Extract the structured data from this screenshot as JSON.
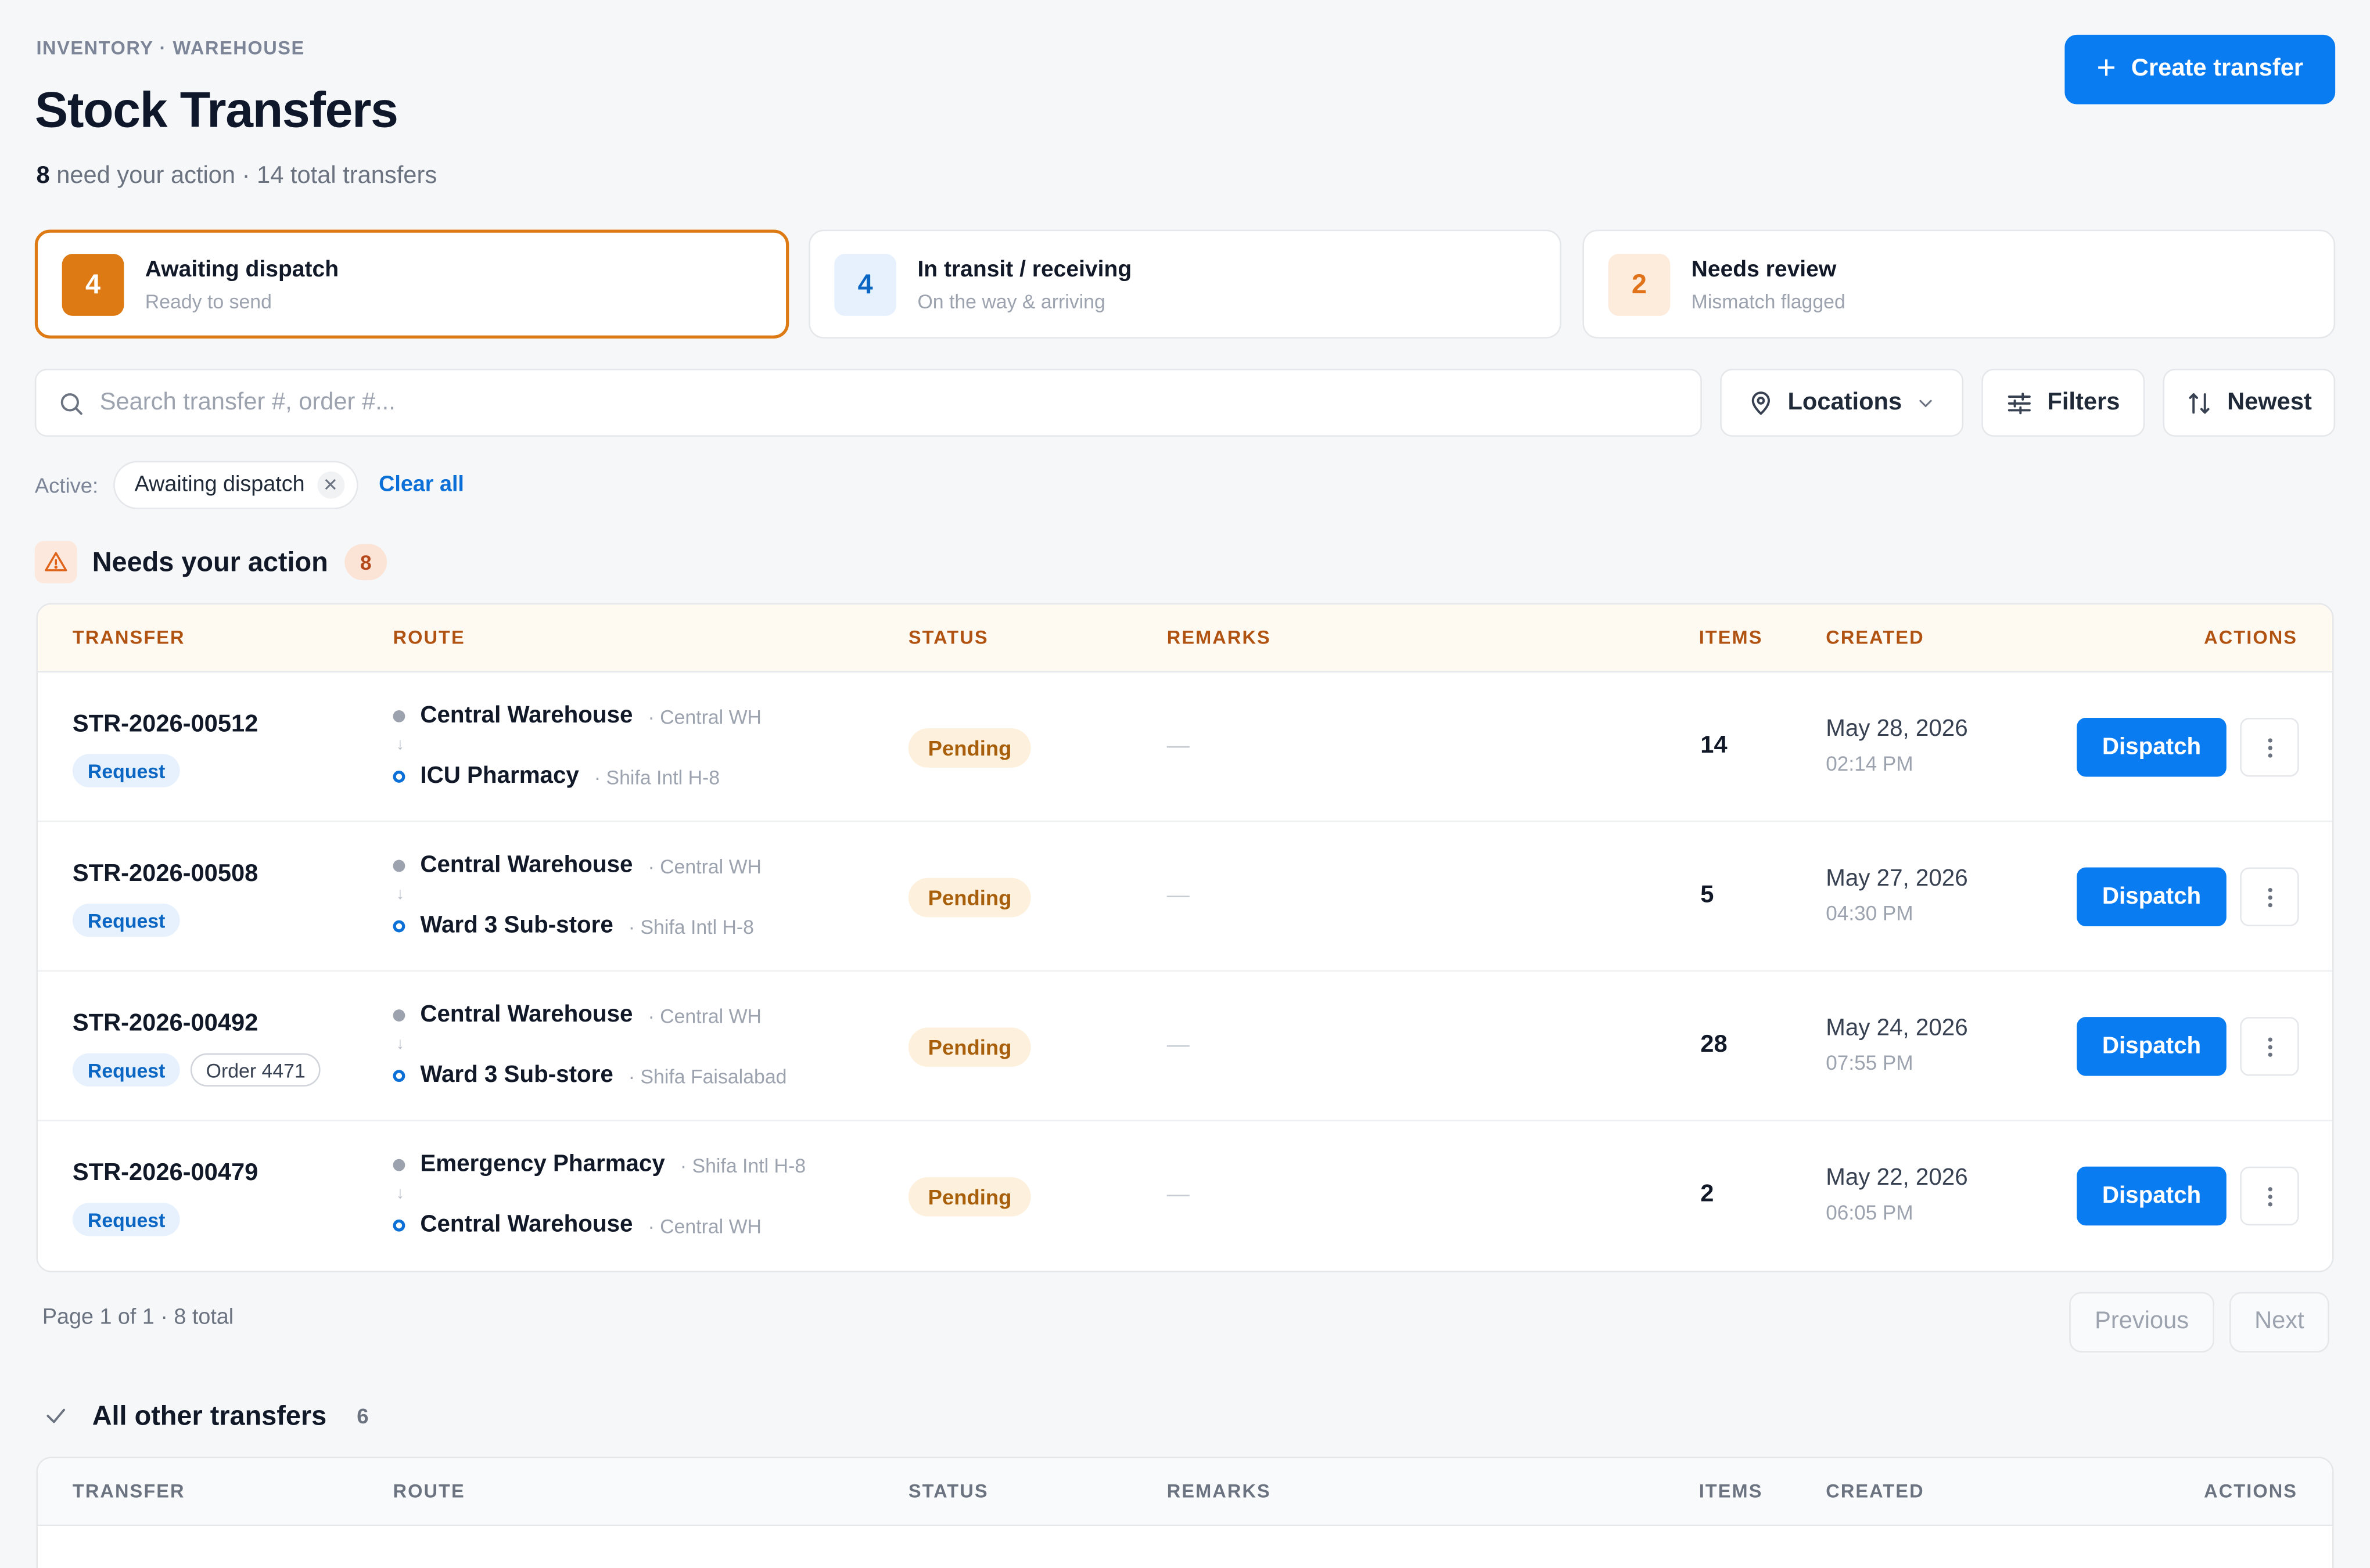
{
  "header": {
    "breadcrumb": "INVENTORY · WAREHOUSE",
    "title": "Stock Transfers",
    "action_count": "8",
    "subtitle_rest": "need your action · 14 total transfers",
    "create_label": "Create transfer"
  },
  "summary_cards": [
    {
      "count": "4",
      "title": "Awaiting dispatch",
      "subtitle": "Ready to send",
      "active": true,
      "color": "#dd7a14"
    },
    {
      "count": "4",
      "title": "In transit / receiving",
      "subtitle": "On the way & arriving",
      "active": false,
      "color": "#0a66c2"
    },
    {
      "count": "2",
      "title": "Needs review",
      "subtitle": "Mismatch flagged",
      "active": false,
      "color": "#e0721a"
    }
  ],
  "search": {
    "placeholder": "Search transfer #, order #...",
    "value": ""
  },
  "toolbar": {
    "locations_label": "Locations",
    "filters_label": "Filters",
    "sort_label": "Newest"
  },
  "active_filters": {
    "label": "Active:",
    "chips": [
      "Awaiting dispatch"
    ],
    "clear_label": "Clear all"
  },
  "columns": [
    "TRANSFER",
    "ROUTE",
    "STATUS",
    "REMARKS",
    "ITEMS",
    "CREATED",
    "ACTIONS"
  ],
  "action_section": {
    "title": "Needs your action",
    "count": "8",
    "rows": [
      {
        "id": "STR-2026-00512",
        "tags": [
          "Request"
        ],
        "from": "Central Warehouse",
        "from_sub": "· Central WH",
        "to": "ICU Pharmacy",
        "to_sub": "· Shifa Intl H-8",
        "status": "Pending",
        "remarks": "—",
        "items": "14",
        "date": "May 28, 2026",
        "time": "02:14 PM",
        "action": "Dispatch"
      },
      {
        "id": "STR-2026-00508",
        "tags": [
          "Request"
        ],
        "from": "Central Warehouse",
        "from_sub": "· Central WH",
        "to": "Ward 3 Sub-store",
        "to_sub": "· Shifa Intl H-8",
        "status": "Pending",
        "remarks": "—",
        "items": "5",
        "date": "May 27, 2026",
        "time": "04:30 PM",
        "action": "Dispatch"
      },
      {
        "id": "STR-2026-00492",
        "tags": [
          "Request",
          "Order 4471"
        ],
        "from": "Central Warehouse",
        "from_sub": "· Central WH",
        "to": "Ward 3 Sub-store",
        "to_sub": "· Shifa Faisalabad",
        "status": "Pending",
        "remarks": "—",
        "items": "28",
        "date": "May 24, 2026",
        "time": "07:55 PM",
        "action": "Dispatch"
      },
      {
        "id": "STR-2026-00479",
        "tags": [
          "Request"
        ],
        "from": "Emergency Pharmacy",
        "from_sub": "· Shifa Intl H-8",
        "to": "Central Warehouse",
        "to_sub": "· Central WH",
        "status": "Pending",
        "remarks": "—",
        "items": "2",
        "date": "May 22, 2026",
        "time": "06:05 PM",
        "action": "Dispatch"
      }
    ]
  },
  "pagination": {
    "text": "Page 1 of 1 · 8 total",
    "prev_label": "Previous",
    "next_label": "Next"
  },
  "other_section": {
    "title": "All other transfers",
    "count": "6"
  },
  "colors": {
    "primary": "#0a7cf2",
    "accent_orange": "#dd7a14",
    "pending_bg": "#fdf0dc",
    "pending_text": "#a85f0c"
  }
}
